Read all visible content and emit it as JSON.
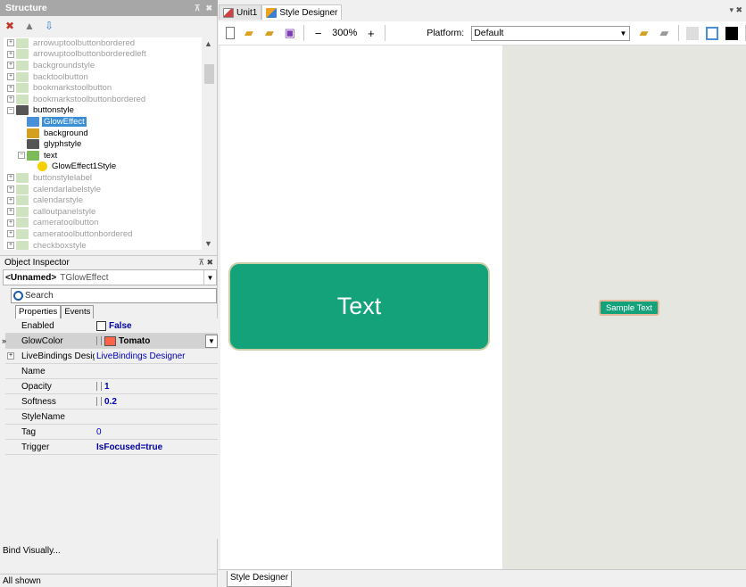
{
  "structure": {
    "title": "Structure",
    "tree": [
      {
        "label": "arrowuptoolbuttonbordered",
        "level": 1,
        "state": "dim"
      },
      {
        "label": "arrowuptoolbuttonborderedleft",
        "level": 1,
        "state": "dim"
      },
      {
        "label": "backgroundstyle",
        "level": 1,
        "state": "dim"
      },
      {
        "label": "backtoolbutton",
        "level": 1,
        "state": "dim"
      },
      {
        "label": "bookmarkstoolbutton",
        "level": 1,
        "state": "dim"
      },
      {
        "label": "bookmarkstoolbuttonbordered",
        "level": 1,
        "state": "dim"
      },
      {
        "label": "buttonstyle",
        "level": 1,
        "state": "normal"
      },
      {
        "label": "GlowEffect",
        "level": 2,
        "state": "selected"
      },
      {
        "label": "background",
        "level": 2,
        "state": "normal"
      },
      {
        "label": "glyphstyle",
        "level": 2,
        "state": "normal"
      },
      {
        "label": "text",
        "level": 2,
        "state": "normal"
      },
      {
        "label": "GlowEffect1Style",
        "level": 3,
        "state": "normal"
      },
      {
        "label": "buttonstylelabel",
        "level": 1,
        "state": "dim"
      },
      {
        "label": "calendarlabelstyle",
        "level": 1,
        "state": "dim"
      },
      {
        "label": "calendarstyle",
        "level": 1,
        "state": "dim"
      },
      {
        "label": "calloutpanelstyle",
        "level": 1,
        "state": "dim"
      },
      {
        "label": "cameratoolbutton",
        "level": 1,
        "state": "dim"
      },
      {
        "label": "cameratoolbuttonbordered",
        "level": 1,
        "state": "dim"
      },
      {
        "label": "checkboxstyle",
        "level": 1,
        "state": "dim"
      }
    ]
  },
  "object_inspector": {
    "title": "Object Inspector",
    "selected_name": "<Unnamed>",
    "selected_type": "TGlowEffect",
    "search_placeholder": "Search",
    "tabs": [
      "Properties",
      "Events"
    ],
    "properties": [
      {
        "name": "Enabled",
        "value": "False",
        "kind": "checkbox"
      },
      {
        "name": "GlowColor",
        "value": "Tomato",
        "kind": "color",
        "color": "#ff6347"
      },
      {
        "name": "LiveBindings Designer",
        "value": "LiveBindings Designer",
        "kind": "link"
      },
      {
        "name": "Name",
        "value": "",
        "kind": "text"
      },
      {
        "name": "Opacity",
        "value": "1",
        "kind": "number"
      },
      {
        "name": "Softness",
        "value": "0.2",
        "kind": "number"
      },
      {
        "name": "StyleName",
        "value": "",
        "kind": "text"
      },
      {
        "name": "Tag",
        "value": "0",
        "kind": "plain"
      },
      {
        "name": "Trigger",
        "value": "IsFocused=true",
        "kind": "bold"
      }
    ],
    "bind_visually": "Bind Visually...",
    "status": "All shown"
  },
  "document_tabs": [
    "Unit1",
    "Style Designer"
  ],
  "designer_toolbar": {
    "zoom_level": "300%",
    "platform_label": "Platform:",
    "platform_value": "Default"
  },
  "preview": {
    "main_button_text": "Text",
    "sample_text": "Sample Text",
    "button_color": "#14a27b",
    "glow_color": "#ff6347"
  },
  "bottom_tab": "Style Designer"
}
